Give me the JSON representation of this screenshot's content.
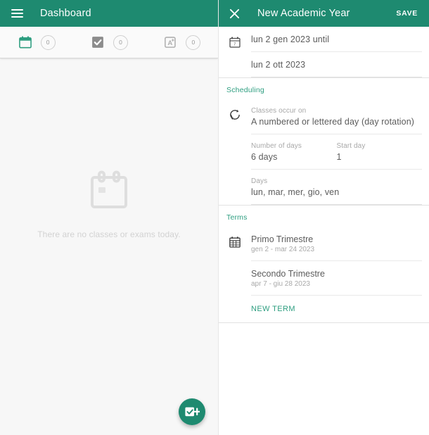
{
  "left": {
    "appbar": {
      "menu_icon": "hamburger-menu-icon",
      "title": "Dashboard"
    },
    "tabs": [
      {
        "icon": "calendar-icon",
        "name": "classes",
        "count": "0"
      },
      {
        "icon": "checkbox-icon",
        "name": "tasks",
        "count": "0"
      },
      {
        "icon": "grade-a-icon",
        "name": "grades",
        "count": "0"
      }
    ],
    "empty_state": {
      "icon": "calendar-empty-icon",
      "message": "There are no classes or exams today."
    },
    "fab": {
      "icon": "add-task-icon",
      "label": ""
    }
  },
  "right": {
    "appbar": {
      "close_icon": "close-icon",
      "title": "New Academic Year",
      "save_label": "SAVE"
    },
    "dates": {
      "icon": "calendar-date-icon",
      "start": "lun 2 gen 2023 until",
      "end": "lun 2 ott 2023"
    },
    "scheduling": {
      "section_title": "Scheduling",
      "icon": "rotation-icon",
      "occur_label": "Classes occur on",
      "occur_value": "A numbered or lettered day (day rotation)",
      "number_of_days_label": "Number of days",
      "number_of_days_value": "6 days",
      "start_day_label": "Start day",
      "start_day_value": "1",
      "days_label": "Days",
      "days_value": "lun, mar, mer, gio, ven"
    },
    "terms": {
      "section_title": "Terms",
      "icon": "calendar-grid-icon",
      "items": [
        {
          "title": "Primo Trimestre",
          "range": "gen 2 - mar 24 2023"
        },
        {
          "title": "Secondo Trimestre",
          "range": "apr 7 - giu 28 2023"
        }
      ],
      "new_term_label": "NEW TERM"
    }
  },
  "colors": {
    "brand_green": "#1e8a70",
    "accent_green": "#2e9e80",
    "left_bg": "#f7f7f7",
    "divider": "#e2e2e2",
    "muted_text": "#a8a8a8"
  }
}
